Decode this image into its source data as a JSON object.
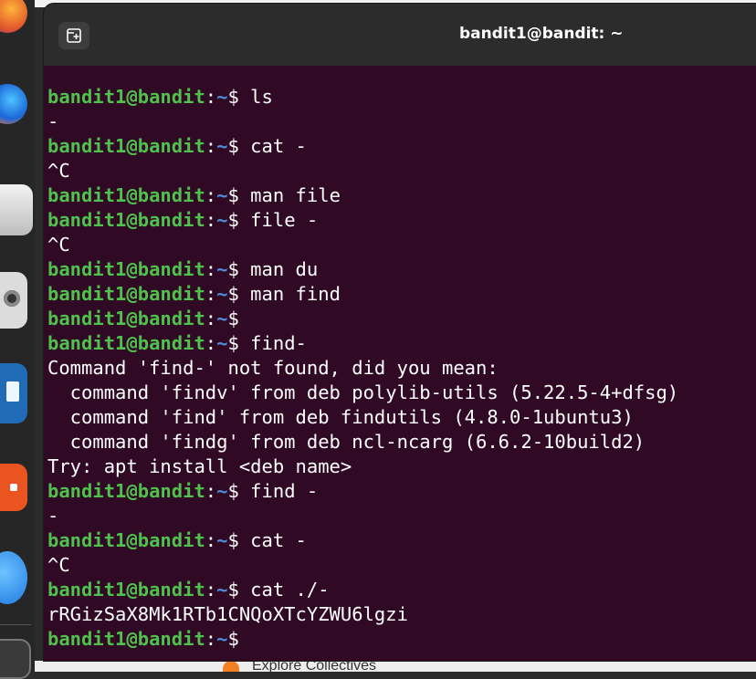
{
  "window": {
    "title": "bandit1@bandit: ~"
  },
  "background": {
    "bottom_label": "Explore Collectives"
  },
  "terminal": {
    "prompt_user": "bandit1@bandit",
    "prompt_sep": ":",
    "prompt_path": "~",
    "prompt_symbol": "$",
    "lines": [
      {
        "type": "prompt",
        "cmd": " ls"
      },
      {
        "type": "out",
        "text": "-"
      },
      {
        "type": "prompt",
        "cmd": " cat -"
      },
      {
        "type": "out",
        "text": "^C"
      },
      {
        "type": "prompt",
        "cmd": " man file"
      },
      {
        "type": "prompt",
        "cmd": " file -"
      },
      {
        "type": "out",
        "text": "^C"
      },
      {
        "type": "prompt",
        "cmd": " man du"
      },
      {
        "type": "prompt",
        "cmd": " man find"
      },
      {
        "type": "prompt",
        "cmd": ""
      },
      {
        "type": "prompt",
        "cmd": " find-"
      },
      {
        "type": "out",
        "text": "Command 'find-' not found, did you mean:"
      },
      {
        "type": "out",
        "text": "  command 'findv' from deb polylib-utils (5.22.5-4+dfsg)"
      },
      {
        "type": "out",
        "text": "  command 'find' from deb findutils (4.8.0-1ubuntu3)"
      },
      {
        "type": "out",
        "text": "  command 'findg' from deb ncl-ncarg (6.6.2-10build2)"
      },
      {
        "type": "out",
        "text": "Try: apt install <deb name>"
      },
      {
        "type": "prompt",
        "cmd": " find -"
      },
      {
        "type": "out",
        "text": "-"
      },
      {
        "type": "prompt",
        "cmd": " cat -"
      },
      {
        "type": "out",
        "text": "^C"
      },
      {
        "type": "prompt",
        "cmd": " cat ./-"
      },
      {
        "type": "out",
        "text": "rRGizSaX8Mk1RTb1CNQoXTcYZWU6lgzi"
      },
      {
        "type": "prompt",
        "cmd": " "
      }
    ]
  }
}
